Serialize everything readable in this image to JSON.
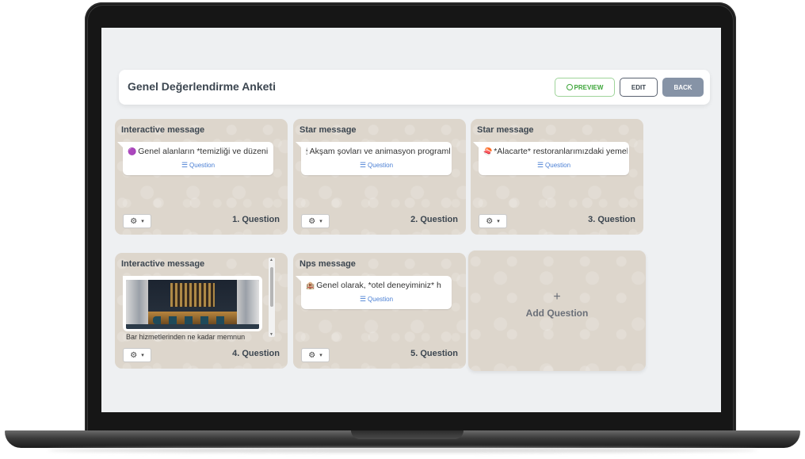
{
  "survey": {
    "title": "Genel Değerlendirme Anketi"
  },
  "actions": {
    "preview_label": "PREVIEW",
    "edit_label": "EDIT",
    "back_label": "BACK"
  },
  "questions": [
    {
      "type": "Interactive message",
      "text": "Genel alanların *temizliği ve düzeni",
      "emoji": "🟣",
      "link": "Question",
      "label": "1. Question"
    },
    {
      "type": "Star message",
      "text": "Akşam şovları ve animasyon programları",
      "emoji": "🕯",
      "link": "Question",
      "label": "2. Question"
    },
    {
      "type": "Star message",
      "text": "*Alacarte* restoranlarımızdaki yemekler",
      "emoji": "🍣",
      "link": "Question",
      "label": "3. Question"
    },
    {
      "type": "Interactive message",
      "text": "Bar hizmetlerinden ne kadar memnun",
      "link": "Question",
      "label": "4. Question"
    },
    {
      "type": "Nps message",
      "text": "Genel olarak, *otel deneyiminiz* h",
      "emoji": "🏨",
      "link": "Question",
      "label": "5. Question"
    }
  ],
  "add": {
    "plus": "+",
    "label": "Add Question"
  },
  "icons": {
    "gear": "⚙",
    "caret": "▾",
    "list": "☰"
  }
}
